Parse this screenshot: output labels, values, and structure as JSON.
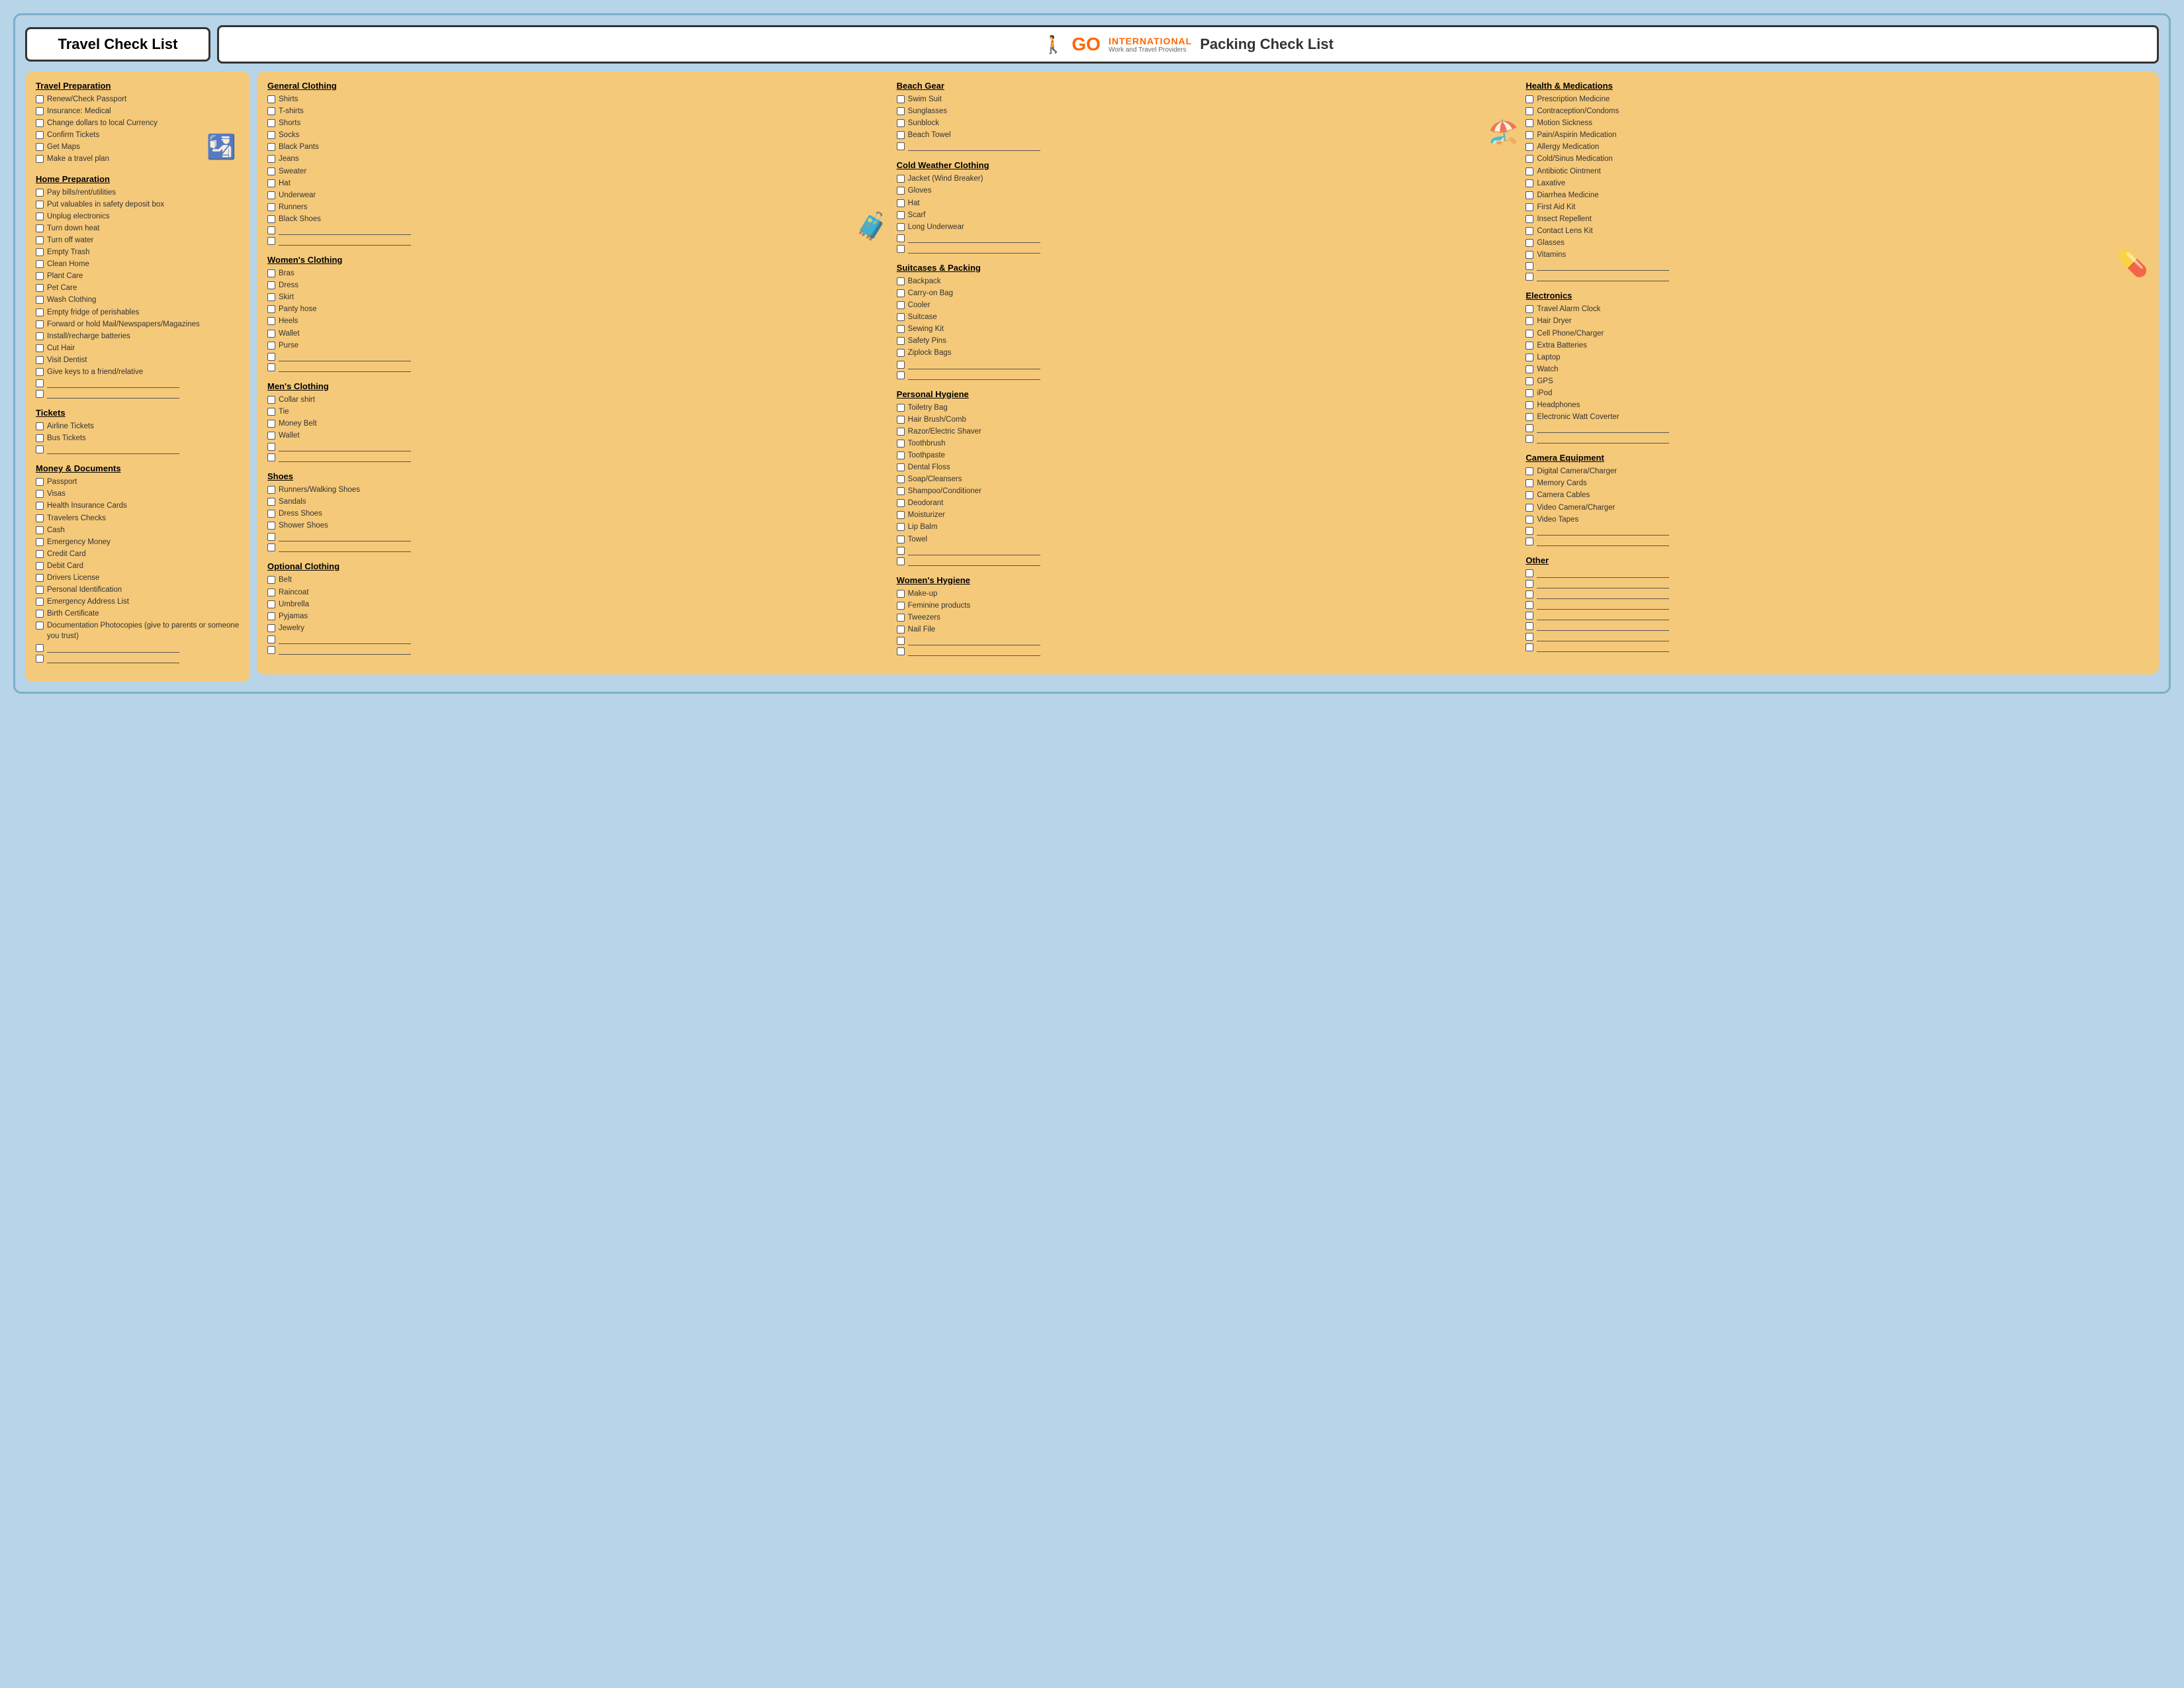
{
  "header": {
    "travel_title": "Travel Check List",
    "logo_icon": "🚶",
    "logo_go": "GO",
    "logo_international": "INTERNATIONAL",
    "logo_sub": "Work and Travel Providers",
    "packing_title": "Packing Check List"
  },
  "left_panel": {
    "sections": [
      {
        "id": "travel-prep",
        "title": "Travel Preparation",
        "items": [
          "Renew/Check Passport",
          "Insurance: Medical",
          "Change dollars to local Currency",
          "Confirm Tickets",
          "Get Maps",
          "Make a travel plan"
        ],
        "blanks": 0
      },
      {
        "id": "home-prep",
        "title": "Home Preparation",
        "items": [
          "Pay bills/rent/utilities",
          "Put valuables in safety deposit box",
          "Unplug electronics",
          "Turn down heat",
          "Turn off water",
          "Empty Trash",
          "Clean Home",
          "Plant Care",
          "Pet Care",
          "Wash Clothing",
          "Empty fridge of perishables",
          "Forward or hold Mail/Newspapers/Magazines",
          "Install/recharge batteries",
          "Cut Hair",
          "Visit Dentist",
          "Give keys to a friend/relative"
        ],
        "blanks": 2
      },
      {
        "id": "tickets",
        "title": "Tickets",
        "items": [
          "Airline Tickets",
          "Bus Tickets"
        ],
        "blanks": 1
      },
      {
        "id": "money-docs",
        "title": "Money & Documents",
        "items": [
          "Passport",
          "Visas",
          "Health Insurance Cards",
          "Travelers Checks",
          "Cash",
          "Emergency Money",
          "Credit Card",
          "Debit Card",
          "Drivers License",
          "Personal Identification",
          "Emergency Address List",
          "Birth Certificate",
          "Documentation Photocopies (give to parents or someone you trust)"
        ],
        "blanks": 2
      }
    ]
  },
  "right_panel": {
    "col1": [
      {
        "id": "general-clothing",
        "title": "General Clothing",
        "items": [
          "Shirts",
          "T-shirts",
          "Shorts",
          "Socks",
          "Black Pants",
          "Jeans",
          "Sweater",
          "Hat",
          "Underwear",
          "Runners",
          "Black Shoes"
        ],
        "blanks": 2
      },
      {
        "id": "womens-clothing",
        "title": "Women's Clothing",
        "items": [
          "Bras",
          "Dress",
          "Skirt",
          "Panty hose",
          "Heels",
          "Wallet",
          "Purse"
        ],
        "blanks": 2
      },
      {
        "id": "mens-clothing",
        "title": "Men's Clothing",
        "items": [
          "Collar shirt",
          "Tie",
          "Money Belt",
          "Wallet"
        ],
        "blanks": 2
      },
      {
        "id": "shoes",
        "title": "Shoes",
        "items": [
          "Runners/Walking Shoes",
          "Sandals",
          "Dress Shoes",
          "Shower Shoes"
        ],
        "blanks": 2
      },
      {
        "id": "optional-clothing",
        "title": "Optional Clothing",
        "items": [
          "Belt",
          "Raincoat",
          "Umbrella",
          "Pyjamas",
          "Jewelry"
        ],
        "blanks": 2
      }
    ],
    "col2": [
      {
        "id": "beach-gear",
        "title": "Beach Gear",
        "items": [
          "Swim Suit",
          "Sunglasses",
          "Sunblock",
          "Beach Towel"
        ],
        "blanks": 1
      },
      {
        "id": "cold-weather",
        "title": "Cold Weather Clothing",
        "items": [
          "Jacket (Wind Breaker)",
          "Gloves",
          "Hat",
          "Scarf",
          "Long Underwear"
        ],
        "blanks": 2
      },
      {
        "id": "suitcases",
        "title": "Suitcases & Packing",
        "items": [
          "Backpack",
          "Carry-on Bag",
          "Cooler",
          "Suitcase",
          "Sewing Kit",
          "Safety Pins",
          "Ziplock Bags"
        ],
        "blanks": 2
      },
      {
        "id": "personal-hygiene",
        "title": "Personal Hygiene",
        "items": [
          "Toiletry Bag",
          "Hair Brush/Comb",
          "Razor/Electric Shaver",
          "Toothbrush",
          "Toothpaste",
          "Dental Floss",
          "Soap/Cleansers",
          "Shampoo/Conditioner",
          "Deodorant",
          "Moisturizer",
          "Lip Balm",
          "Towel"
        ],
        "blanks": 2
      },
      {
        "id": "womens-hygiene",
        "title": "Women's Hygiene",
        "items": [
          "Make-up",
          "Feminine products",
          "Tweezers",
          "Nail File"
        ],
        "blanks": 2
      }
    ],
    "col3": [
      {
        "id": "health-meds",
        "title": "Health & Medications",
        "items": [
          "Prescription Medicine",
          "Contraception/Condoms",
          "Motion Sickness",
          "Pain/Aspirin Medication",
          "Allergy Medication",
          "Cold/Sinus Medication",
          "Antibiotic Ointment",
          "Laxative",
          "Diarrhea Medicine",
          "First Aid Kit",
          "Insect Repellent",
          "Contact Lens Kit",
          "Glasses",
          "Vitamins"
        ],
        "blanks": 2
      },
      {
        "id": "electronics",
        "title": "Electronics",
        "items": [
          "Travel Alarm Clock",
          "Hair Dryer",
          "Cell Phone/Charger",
          "Extra Batteries",
          "Laptop",
          "Watch",
          "GPS",
          "iPod",
          "Headphones",
          "Electronic Watt Coverter"
        ],
        "blanks": 2
      },
      {
        "id": "camera",
        "title": "Camera Equipment",
        "items": [
          "Digital Camera/Charger",
          "Memory Cards",
          "Camera Cables",
          "Video Camera/Charger",
          "Video Tapes"
        ],
        "blanks": 2
      },
      {
        "id": "other",
        "title": "Other",
        "items": [],
        "blanks": 8
      }
    ]
  }
}
